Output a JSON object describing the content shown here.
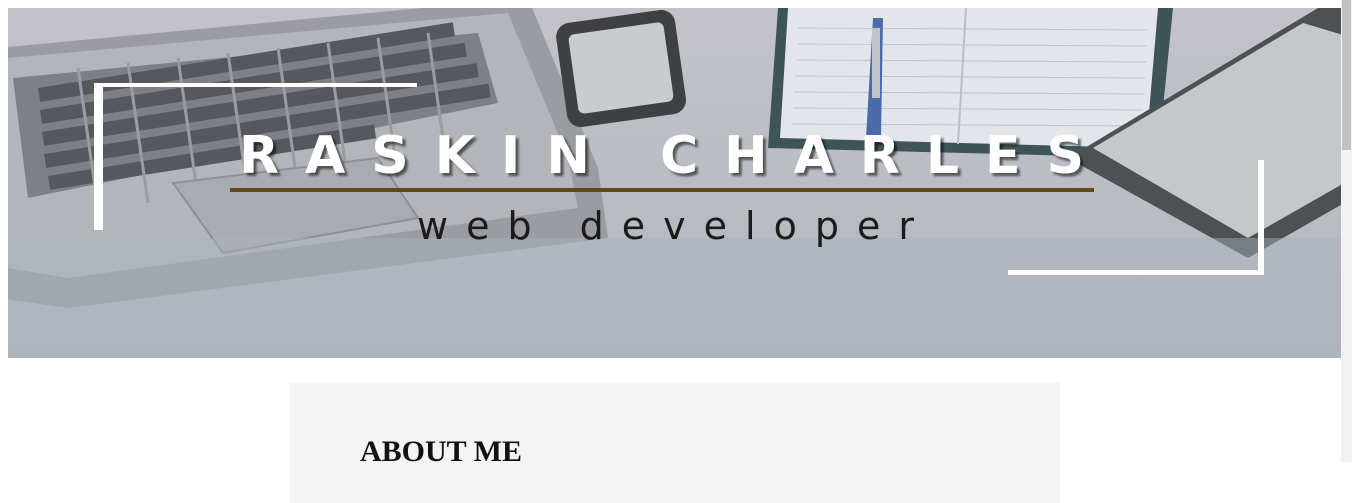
{
  "hero": {
    "name": "RASKIN CHARLES",
    "role": "web developer"
  },
  "about": {
    "heading": "ABOUT ME"
  },
  "colors": {
    "underline": "#5a4a1c",
    "card_background": "#f4f4f4"
  }
}
